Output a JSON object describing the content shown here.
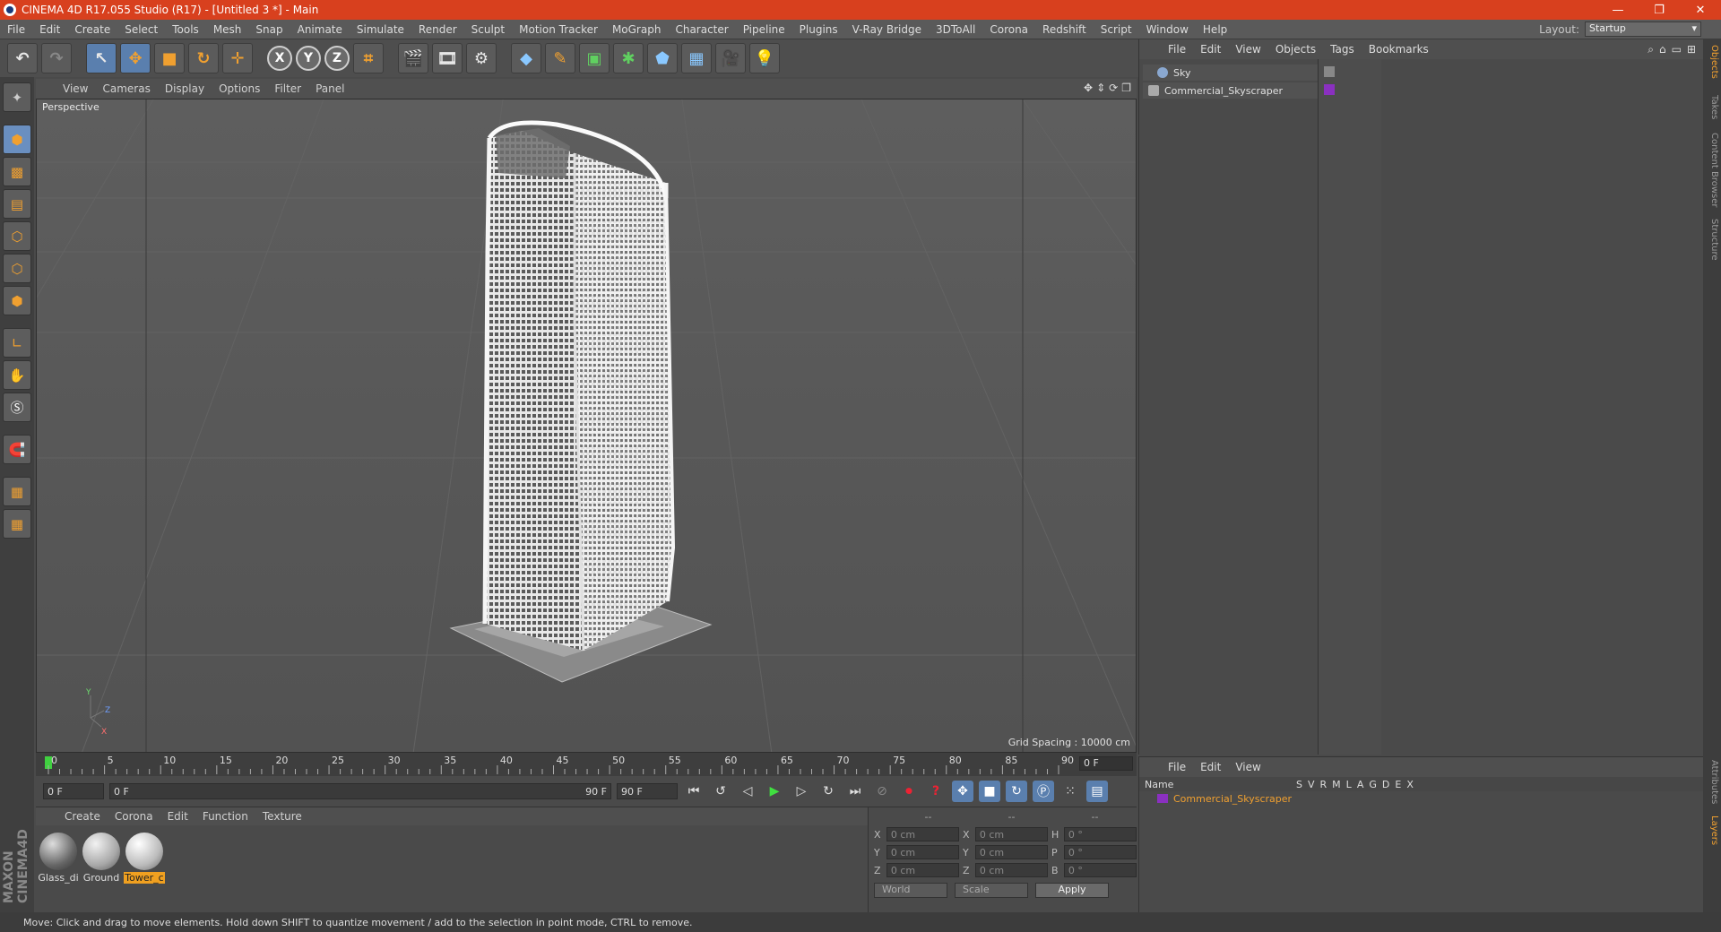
{
  "window": {
    "title": "CINEMA 4D R17.055 Studio (R17) - [Untitled 3 *] - Main",
    "minimize": "—",
    "maximize": "❐",
    "close": "✕"
  },
  "menu": [
    "File",
    "Edit",
    "Create",
    "Select",
    "Tools",
    "Mesh",
    "Snap",
    "Animate",
    "Simulate",
    "Render",
    "Sculpt",
    "Motion Tracker",
    "MoGraph",
    "Character",
    "Pipeline",
    "Plugins",
    "V-Ray Bridge",
    "3DToAll",
    "Corona",
    "Redshift",
    "Script",
    "Window",
    "Help"
  ],
  "layout": {
    "label": "Layout:",
    "value": "Startup"
  },
  "toolbar": {
    "undo": "↶",
    "redo": "↷",
    "select": "↖",
    "move": "✥",
    "scale": "■",
    "rotate": "↻",
    "add": "✛",
    "x": "X",
    "y": "Y",
    "z": "Z",
    "coord": "⌗"
  },
  "viewport": {
    "menu": [
      "View",
      "Cameras",
      "Display",
      "Options",
      "Filter",
      "Panel"
    ],
    "label": "Perspective",
    "grid_spacing": "Grid Spacing : 10000 cm",
    "axis_y": "Y",
    "axis_z": "Z",
    "axis_x": "X"
  },
  "timeline": {
    "ticks": [
      "0",
      "5",
      "10",
      "15",
      "20",
      "25",
      "30",
      "35",
      "40",
      "45",
      "50",
      "55",
      "60",
      "65",
      "70",
      "75",
      "80",
      "85",
      "90"
    ],
    "current": "0 F"
  },
  "transport": {
    "start": "0 F",
    "range_start": "0 F",
    "range_end": "90 F",
    "end": "90 F"
  },
  "materials": {
    "menu": [
      "Create",
      "Corona",
      "Edit",
      "Function",
      "Texture"
    ],
    "items": [
      {
        "name": "Glass_di",
        "color": "#8a8a8a"
      },
      {
        "name": "Ground",
        "color": "#bdbdbd"
      },
      {
        "name": "Tower_c",
        "color": "#d4d4d4"
      }
    ]
  },
  "coords": {
    "headers": [
      "--",
      "--",
      "--"
    ],
    "rows": [
      {
        "a": "X",
        "av": "0 cm",
        "b": "X",
        "bv": "0 cm",
        "c": "H",
        "cv": "0 °"
      },
      {
        "a": "Y",
        "av": "0 cm",
        "b": "Y",
        "bv": "0 cm",
        "c": "P",
        "cv": "0 °"
      },
      {
        "a": "Z",
        "av": "0 cm",
        "b": "Z",
        "bv": "0 cm",
        "c": "B",
        "cv": "0 °"
      }
    ],
    "mode": "World",
    "size_mode": "Scale",
    "apply": "Apply"
  },
  "objects": {
    "menu": [
      "File",
      "Edit",
      "View",
      "Objects",
      "Tags",
      "Bookmarks"
    ],
    "items": [
      {
        "name": "Sky",
        "color": "#8aa8d0"
      },
      {
        "name": "Commercial_Skyscraper",
        "color": "#aaaaaa"
      }
    ]
  },
  "layers": {
    "menu": [
      "File",
      "Edit",
      "View"
    ],
    "header_name": "Name",
    "cols": [
      "S",
      "V",
      "R",
      "M",
      "L",
      "A",
      "G",
      "D",
      "E",
      "X"
    ],
    "item": "Commercial_Skyscraper"
  },
  "right_tabs": [
    "Objects",
    "Takes",
    "Content Browser",
    "Structure",
    "Attributes",
    "Layers"
  ],
  "status": "Move: Click and drag to move elements. Hold down SHIFT to quantize movement / add to the selection in point mode, CTRL to remove."
}
